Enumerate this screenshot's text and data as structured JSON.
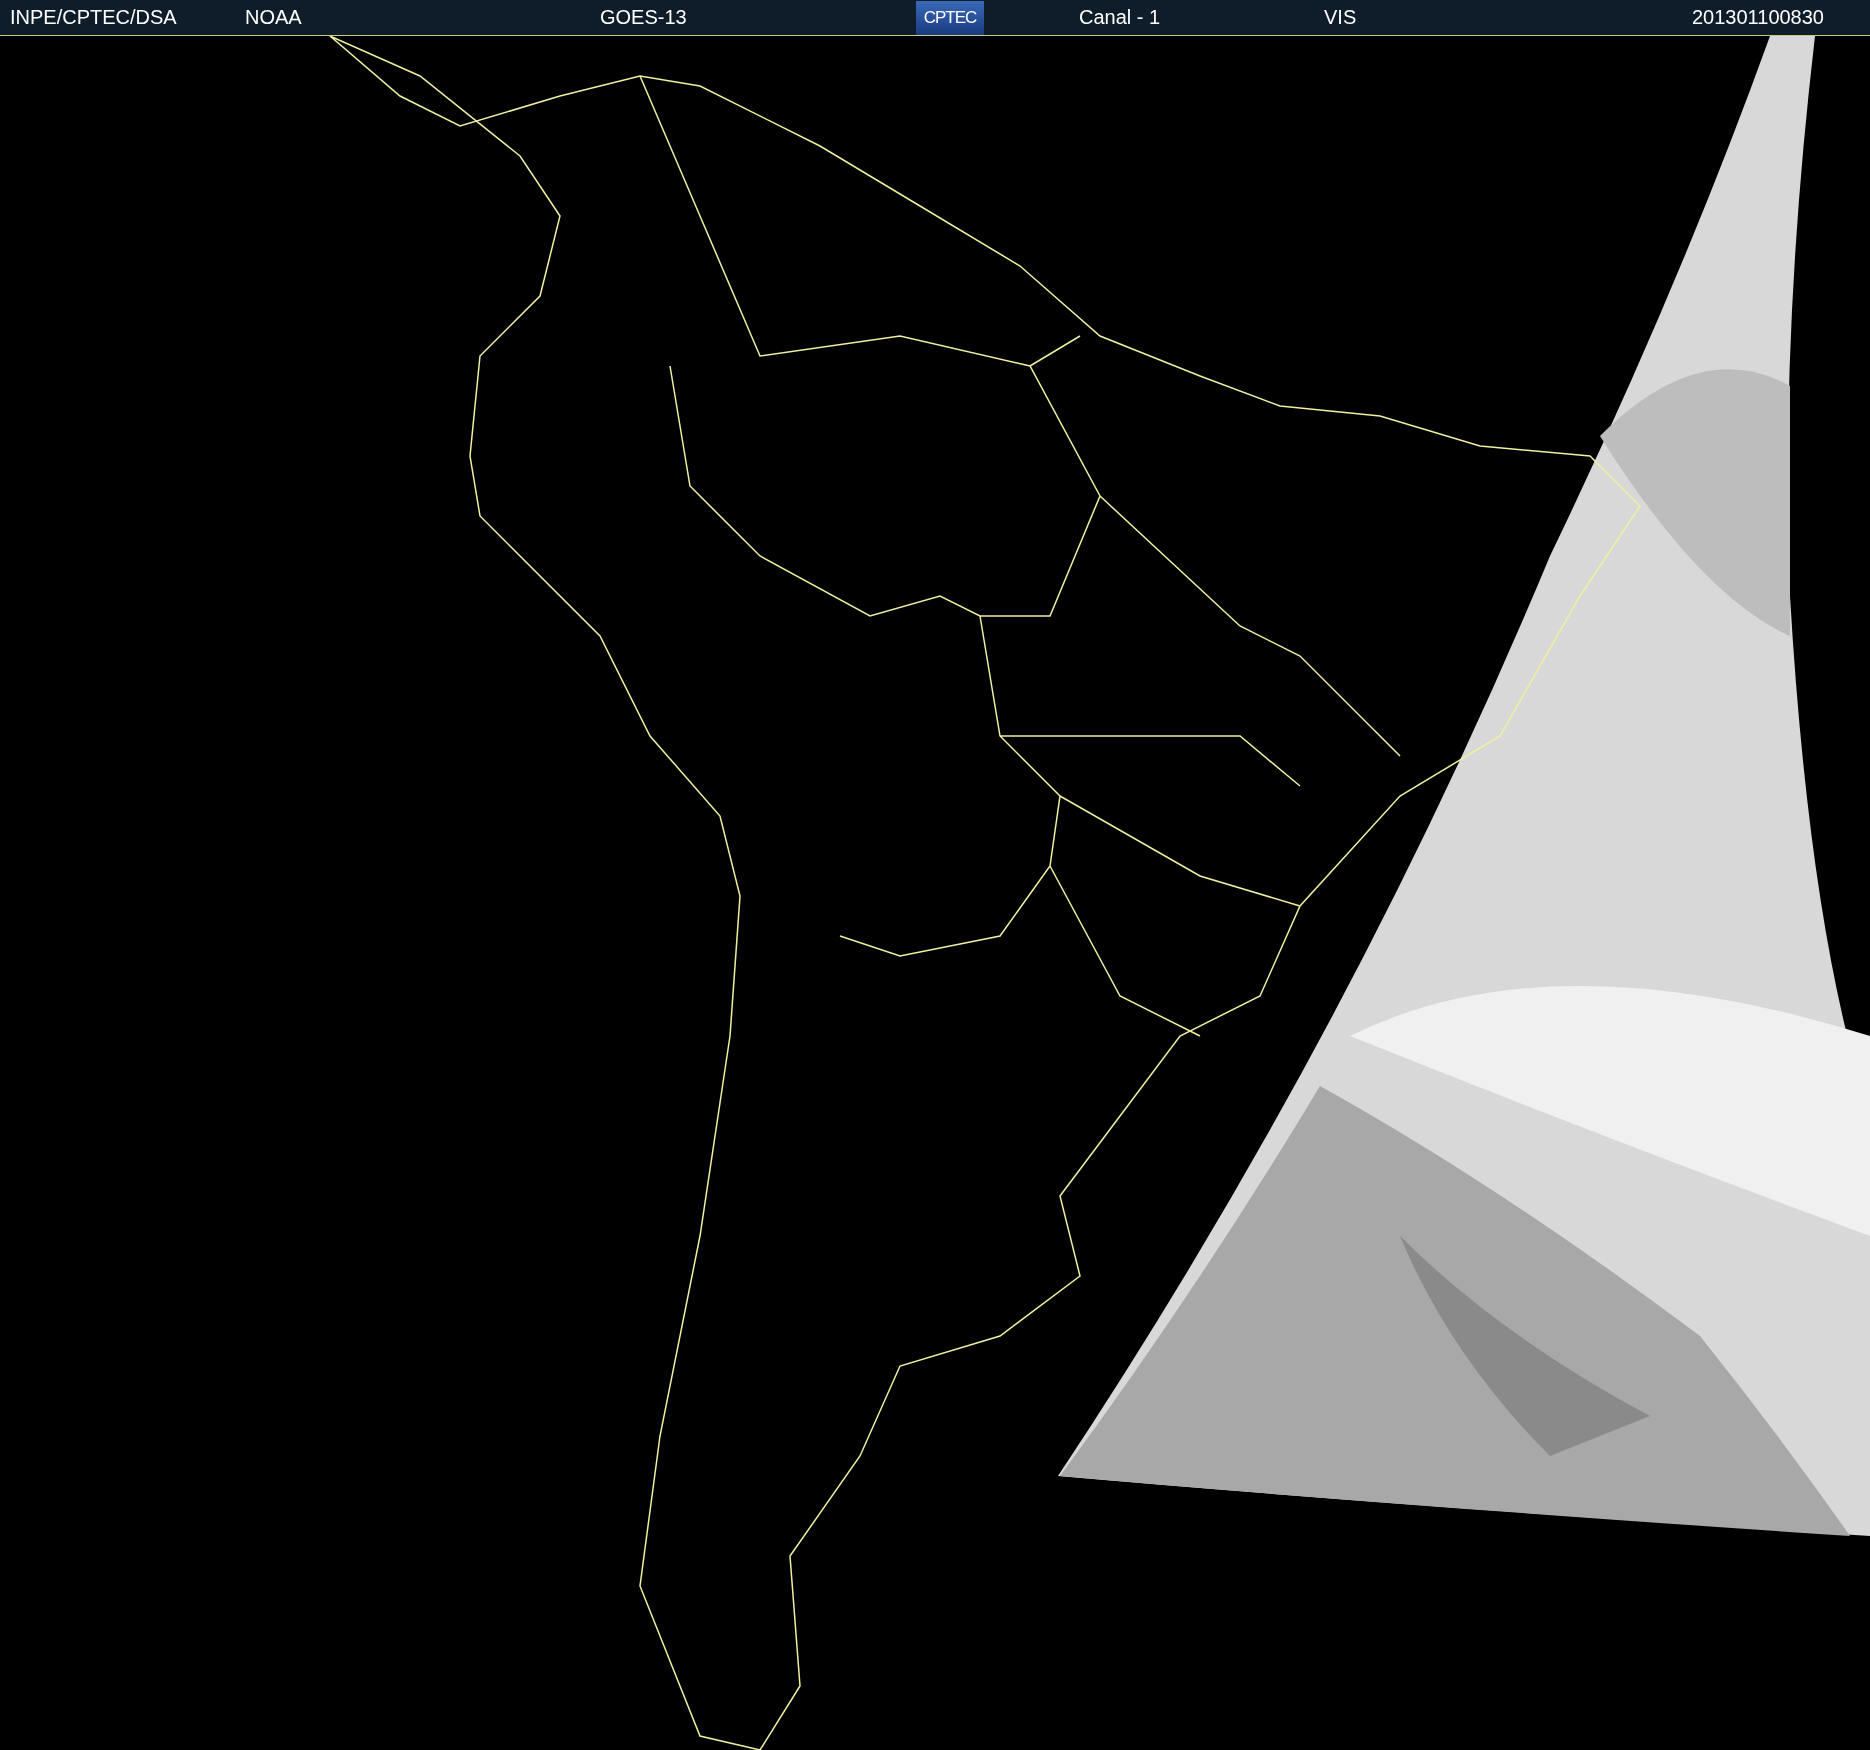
{
  "header": {
    "institution": "INPE/CPTEC/DSA",
    "agency": "NOAA",
    "satellite": "GOES-13",
    "logo": "CPTEC",
    "channel": "Canal - 1",
    "band": "VIS",
    "timestamp": "201301100830"
  }
}
